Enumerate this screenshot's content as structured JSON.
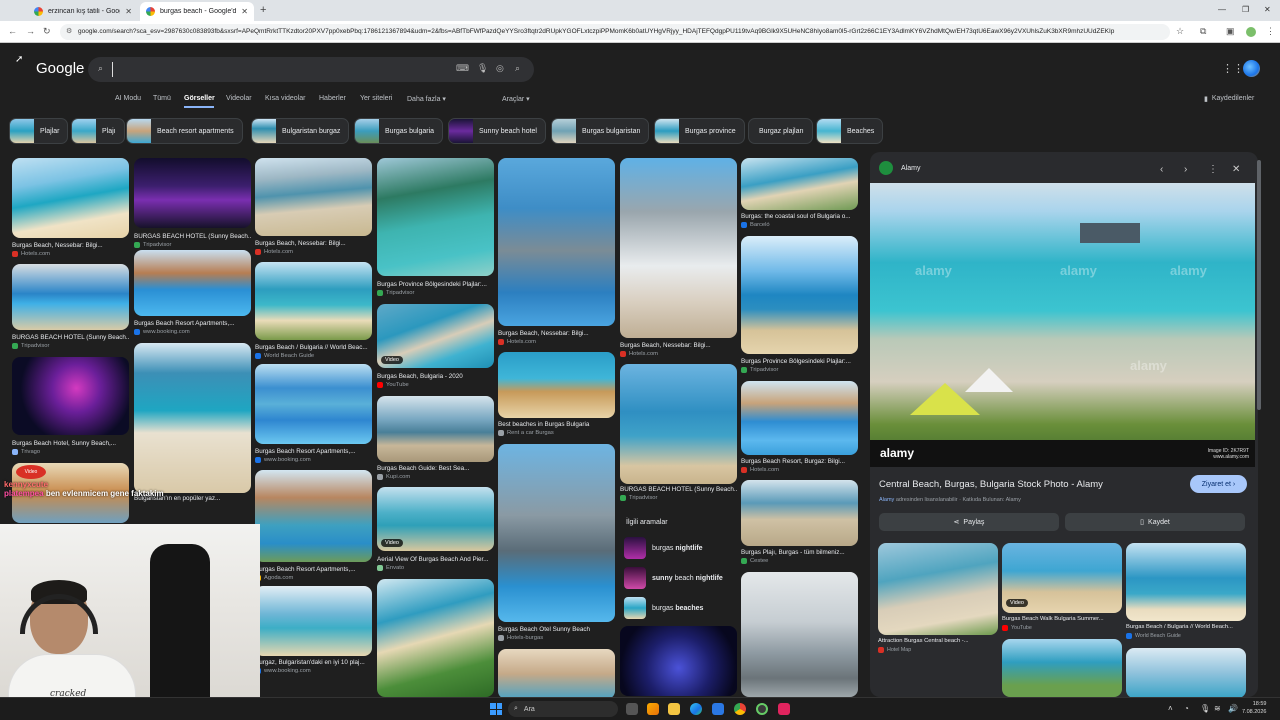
{
  "browser": {
    "tabs": [
      {
        "title": "erzincan kış tatili - Google'da A"
      },
      {
        "title": "burgas beach - Google'da Ara"
      }
    ],
    "url": "google.com/search?sca_esv=2987630c083893fb&sxsrf=APeQmtRrktTTKzdtor20PXV7pp0xebPbq:1786121367894&udm=2&fbs=ABfTbFWfPazdQeYYSro3ftqtr2dRUpkYGOFLxtczpiPPMomK6b0atUYHgVRjyy_HDAjTEFQdgpPU119tvAq9BGlk9X5UHeNC8hIyo8am0l5-rGrt2z66C1EY3AdlmKY6VZhdMtQw/EH73qtU6EawX96y2VXUhlsZuK3bXR9mhzUUdZEKIp"
  },
  "google": {
    "logo": "Google",
    "search_value": "",
    "filters": [
      "AI Modu",
      "Tümü",
      "Görseller",
      "Videolar",
      "Kısa videolar",
      "Haberler",
      "Yer siteleri",
      "Daha fazla ▾"
    ],
    "tools": "Araçlar ▾",
    "saved": "Kaydedilenler"
  },
  "chips": [
    "Plajlar",
    "Plajı",
    "Beach resort apartments",
    "Bulgaristan burgaz",
    "Burgas bulgaria",
    "Sunny beach hotel",
    "Burgas bulgaristan",
    "Burgas province",
    "Burgaz plajları",
    "Beaches"
  ],
  "results": [
    {
      "caption": "Burgas Beach, Nessebar: Bilgi...",
      "source": "Hotels.com",
      "src_color": "#d93025"
    },
    {
      "caption": "BURGAS BEACH HOTEL (Sunny Beach...",
      "source": "Tripadvisor",
      "src_color": "#34a853"
    },
    {
      "caption": "Burgas Beach Hotel, Sunny Beach,...",
      "source": "Trivago",
      "src_color": "#8ab4f8"
    },
    {
      "caption": "BURGAS BEACH HOTEL (Sunny Beach...",
      "source": "Tripadvisor",
      "src_color": "#34a853"
    },
    {
      "caption": "Burgas Beach Resort Apartments,...",
      "source": "www.booking.com",
      "src_color": "#1a73e8"
    },
    {
      "caption": "Bulgaristan'ın en popüler yaz...",
      "source": "Instagram",
      "src_color": "#e1306c"
    },
    {
      "caption": "Burgas Beach, Nessebar: Bilgi...",
      "source": "Hotels.com",
      "src_color": "#d93025"
    },
    {
      "caption": "Burgas Beach / Bulgaria // World Beac...",
      "source": "World Beach Guide",
      "src_color": "#1a73e8"
    },
    {
      "caption": "Burgas Beach Resort Apartments,...",
      "source": "www.booking.com",
      "src_color": "#1a73e8"
    },
    {
      "caption": "Burgas Beach Resort Apartments,...",
      "source": "Agoda.com",
      "src_color": "#fbbc05"
    },
    {
      "caption": "Burgaz, Bulgaristan'daki en iyi 10 plaj...",
      "source": "www.booking.com",
      "src_color": "#1a73e8"
    },
    {
      "caption": "Burgas Province Bölgesindeki Plajlar:...",
      "source": "Tripadvisor",
      "src_color": "#34a853"
    },
    {
      "caption": "Burgas Beach, Bulgaria - 2020",
      "source": "YouTube",
      "src_color": "#ff0000"
    },
    {
      "caption": "Burgas Beach Guide: Best Sea...",
      "source": "Kupi.com",
      "src_color": "#9aa0a6"
    },
    {
      "caption": "Aerial View Of Burgas Beach And Pier...",
      "source": "Envato",
      "src_color": "#81c995"
    },
    {
      "caption": "Burgas Beach, Nessebar: Bilgi...",
      "source": "Hotels.com",
      "src_color": "#d93025"
    },
    {
      "caption": "Best beaches in Burgas Bulgaria",
      "source": "Rent a car Burgas",
      "src_color": "#9aa0a6"
    },
    {
      "caption": "Burgas Beach Otel Sunny Beach",
      "source": "Hotels-burgas",
      "src_color": "#9aa0a6"
    },
    {
      "caption": "Burgas Beach, Nessebar: Bilgi...",
      "source": "Hotels.com",
      "src_color": "#d93025"
    },
    {
      "caption": "BURGAS BEACH HOTEL (Sunny Beach...",
      "source": "Tripadvisor",
      "src_color": "#34a853"
    },
    {
      "caption": "Burgas: the coastal soul of Bulgaria o...",
      "source": "Barceló",
      "src_color": "#1a73e8"
    },
    {
      "caption": "Burgas Province Bölgesindeki Plajlar:...",
      "source": "Tripadvisor",
      "src_color": "#34a853"
    },
    {
      "caption": "Burgas Beach Resort, Burgaz: Bilgi...",
      "source": "Hotels.com",
      "src_color": "#d93025"
    },
    {
      "caption": "Burgas Plajı, Burgas - tüm bilmeniz...",
      "source": "Cestee",
      "src_color": "#34a853"
    }
  ],
  "video_label": "Video",
  "related": {
    "heading": "İlgili aramalar",
    "items": [
      {
        "prefix": "burgas",
        "bold": "nightlife"
      },
      {
        "prefix": "sunny",
        "mid": "beach",
        "bold": "nightlife"
      },
      {
        "prefix": "burgas",
        "bold": "beaches"
      }
    ]
  },
  "panel": {
    "source": "Alamy",
    "title": "Central Beach, Burgas, Bulgaria Stock Photo - Alamy",
    "visit_label": "Ziyaret et",
    "subtitle_source": "Alamy",
    "subtitle_rest": "adresinden lisanslanabilir · Katkıda Bulunan: Alamy",
    "share_label": "Paylaş",
    "save_label": "Kaydet",
    "watermark": "alamy",
    "footer_id": "Image ID: 2K7R9T",
    "footer_site": "www.alamy.com",
    "related": [
      {
        "caption": "Attraction Burgas Central beach -...",
        "source": "Hotel Map",
        "src_color": "#d93025"
      },
      {
        "caption": "Burgas Beach Walk Bulgaria Summer...",
        "source": "YouTube",
        "src_color": "#ff0000"
      },
      {
        "caption": "Burgas Beach / Bulgaria // World Beach...",
        "source": "World Beach Guide",
        "src_color": "#1a73e8"
      }
    ]
  },
  "overlay": {
    "badge": "Video",
    "chat_user": "kennyxcute",
    "chat_user2": "platempea",
    "chat_message": "ben evlenmicem gene faktakim",
    "shirt_text": "cracked"
  },
  "taskbar": {
    "search": "Ara",
    "time": "18:59",
    "date": "7.08.2026"
  }
}
